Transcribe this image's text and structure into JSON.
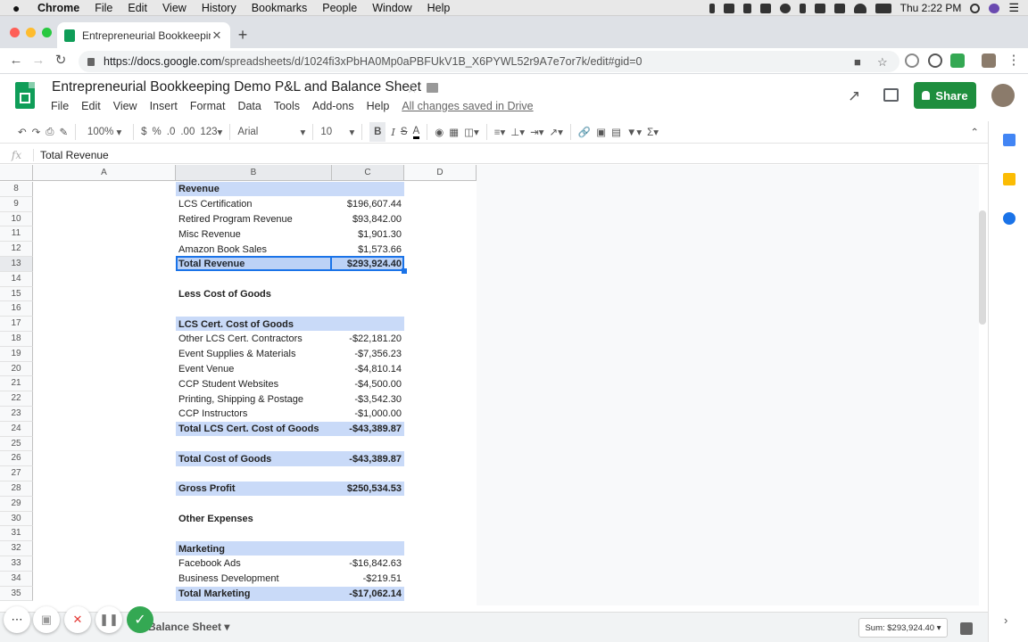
{
  "mac_menu": {
    "app": "Chrome",
    "items": [
      "File",
      "Edit",
      "View",
      "History",
      "Bookmarks",
      "People",
      "Window",
      "Help"
    ],
    "clock": "Thu 2:22 PM"
  },
  "browser": {
    "tab_title": "Entrepreneurial Bookkeeping D",
    "url_host": "https://docs.google.com",
    "url_path": "/spreadsheets/d/1024fi3xPbHA0Mp0aPBFUkV1B_X6PYWL52r9A7e7or7k/edit#gid=0"
  },
  "doc": {
    "title": "Entrepreneurial Bookkeeping Demo P&L and Balance Sheet",
    "menus": [
      "File",
      "Edit",
      "View",
      "Insert",
      "Format",
      "Data",
      "Tools",
      "Add-ons",
      "Help"
    ],
    "saved_status": "All changes saved in Drive",
    "share_label": "Share"
  },
  "toolbar": {
    "zoom": "100%",
    "currency": "$",
    "percent": "%",
    "dec_less": ".0",
    "dec_more": ".00",
    "more_formats": "123",
    "font": "Arial",
    "size": "10"
  },
  "formula_bar": {
    "fx": "fx",
    "value": "Total Revenue"
  },
  "columns": [
    "A",
    "B",
    "C",
    "D"
  ],
  "rows": [
    {
      "n": "8",
      "b": "Revenue",
      "c": "",
      "bold": true,
      "band": true
    },
    {
      "n": "9",
      "b": "LCS Certification",
      "c": "$196,607.44"
    },
    {
      "n": "10",
      "b": "Retired Program Revenue",
      "c": "$93,842.00"
    },
    {
      "n": "11",
      "b": "Misc Revenue",
      "c": "$1,901.30"
    },
    {
      "n": "12",
      "b": "Amazon Book Sales",
      "c": "$1,573.66"
    },
    {
      "n": "13",
      "b": "Total Revenue",
      "c": "$293,924.40",
      "bold": true,
      "band": true,
      "selected": true
    },
    {
      "n": "14",
      "b": "",
      "c": ""
    },
    {
      "n": "15",
      "b": "Less Cost of Goods",
      "c": "",
      "bold": true,
      "large": true
    },
    {
      "n": "16",
      "b": "",
      "c": ""
    },
    {
      "n": "17",
      "b": "LCS Cert. Cost of Goods",
      "c": "",
      "bold": true,
      "band": true
    },
    {
      "n": "18",
      "b": "Other LCS Cert. Contractors",
      "c": "-$22,181.20"
    },
    {
      "n": "19",
      "b": "Event Supplies & Materials",
      "c": "-$7,356.23"
    },
    {
      "n": "20",
      "b": "Event Venue",
      "c": "-$4,810.14"
    },
    {
      "n": "21",
      "b": "CCP Student Websites",
      "c": "-$4,500.00"
    },
    {
      "n": "22",
      "b": "Printing, Shipping & Postage",
      "c": "-$3,542.30"
    },
    {
      "n": "23",
      "b": "CCP Instructors",
      "c": "-$1,000.00"
    },
    {
      "n": "24",
      "b": "Total LCS Cert. Cost of Goods",
      "c": "-$43,389.87",
      "bold": true,
      "band": true
    },
    {
      "n": "25",
      "b": "",
      "c": ""
    },
    {
      "n": "26",
      "b": "Total Cost of Goods",
      "c": "-$43,389.87",
      "bold": true,
      "band": true
    },
    {
      "n": "27",
      "b": "",
      "c": ""
    },
    {
      "n": "28",
      "b": "Gross Profit",
      "c": "$250,534.53",
      "bold": true,
      "band": true
    },
    {
      "n": "29",
      "b": "",
      "c": ""
    },
    {
      "n": "30",
      "b": "Other Expenses",
      "c": "",
      "bold": true
    },
    {
      "n": "31",
      "b": "",
      "c": ""
    },
    {
      "n": "32",
      "b": "Marketing",
      "c": "",
      "bold": true,
      "band": true
    },
    {
      "n": "33",
      "b": "Facebook Ads",
      "c": "-$16,842.63"
    },
    {
      "n": "34",
      "b": "Business Development",
      "c": "-$219.51"
    },
    {
      "n": "35",
      "b": "Total Marketing",
      "c": "-$17,062.14",
      "bold": true,
      "band": true
    }
  ],
  "bottom": {
    "sheet_tab": "Balance Sheet",
    "sum": "Sum: $293,924.40"
  },
  "colors": {
    "band": "#c9daf8",
    "selection": "#1a73e8",
    "share": "#1e8e3e",
    "sheets_green": "#0f9d58"
  }
}
